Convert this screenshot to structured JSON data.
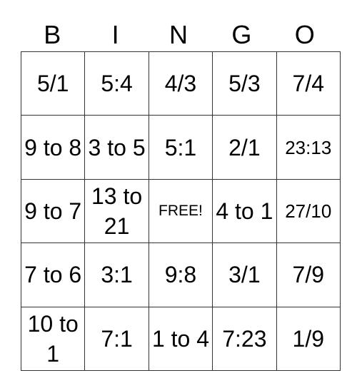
{
  "header": [
    "B",
    "I",
    "N",
    "G",
    "O"
  ],
  "cells": [
    [
      "5/1",
      "5:4",
      "4/3",
      "5/3",
      "7/4"
    ],
    [
      "9 to 8",
      "3 to 5",
      "5:1",
      "2/1",
      "23:13"
    ],
    [
      "9 to 7",
      "13 to 21",
      "FREE!",
      "4 to 1",
      "27/10"
    ],
    [
      "7 to 6",
      "3:1",
      "9:8",
      "3/1",
      "7/9"
    ],
    [
      "10 to 1",
      "7:1",
      "1 to 4",
      "7:23",
      "1/9"
    ]
  ]
}
